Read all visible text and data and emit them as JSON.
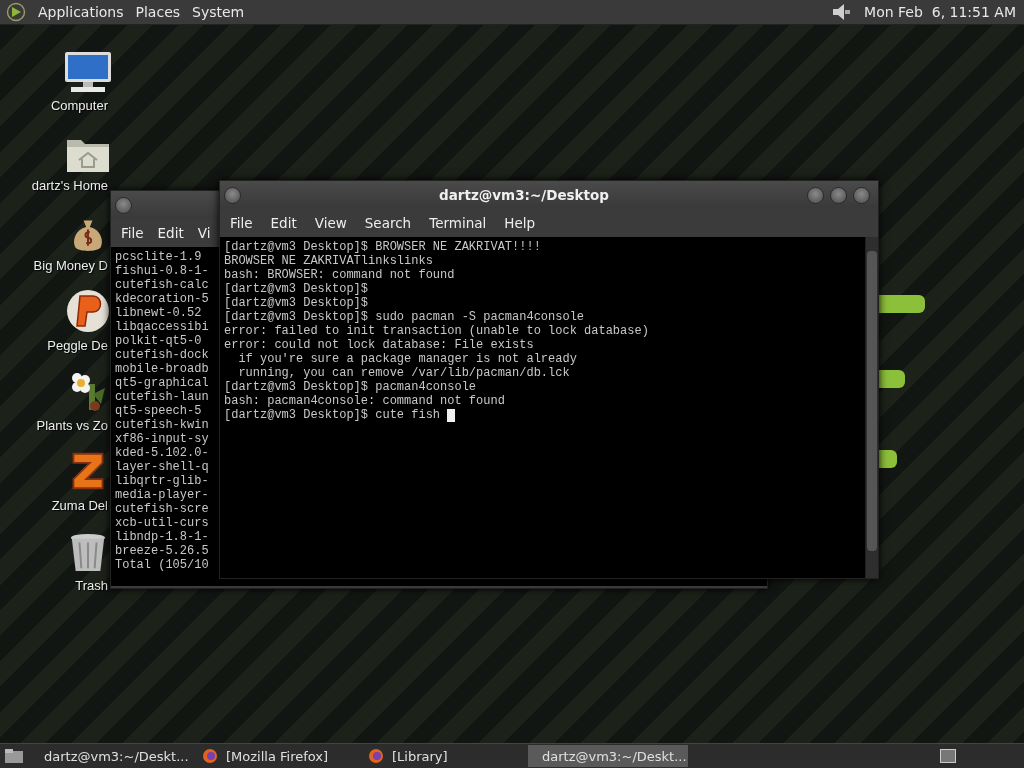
{
  "top_panel": {
    "menus": [
      "Applications",
      "Places",
      "System"
    ],
    "clock": "Mon Feb  6, 11:51 AM"
  },
  "desktop_icons": [
    {
      "kind": "computer",
      "label": "Computer"
    },
    {
      "kind": "home",
      "label": "dartz's Home"
    },
    {
      "kind": "money",
      "label": "Big Money D"
    },
    {
      "kind": "peggle",
      "label": "Peggle De"
    },
    {
      "kind": "plants",
      "label": "Plants vs Zo"
    },
    {
      "kind": "zuma",
      "label": "Zuma Del"
    },
    {
      "kind": "trash",
      "label": "Trash"
    }
  ],
  "back_window": {
    "menus": [
      "File",
      "Edit",
      "Vi"
    ],
    "lines": [
      "pcsclite-1.9",
      "fishui-0.8-1-",
      "cutefish-calc",
      "kdecoration-5",
      "libnewt-0.52",
      "libqaccessibi",
      "polkit-qt5-0",
      "cutefish-dock",
      "mobile-broadb",
      "qt5-graphical",
      "cutefish-laun",
      "qt5-speech-5",
      "cutefish-kwin",
      "xf86-input-sy",
      "kded-5.102.0-",
      "layer-shell-q",
      "libqrtr-glib-",
      "media-player-",
      "cutefish-scre",
      "xcb-util-curs",
      "libndp-1.8-1-",
      "breeze-5.26.5",
      "Total (105/10"
    ]
  },
  "front_window": {
    "title": "dartz@vm3:~/Desktop",
    "menus": [
      "File",
      "Edit",
      "View",
      "Search",
      "Terminal",
      "Help"
    ],
    "lines": [
      "[dartz@vm3 Desktop]$ BROWSER NE ZAKRIVAT!!!!",
      "BROWSER NE ZAKRIVATlinkslinks",
      "bash: BROWSER: command not found",
      "[dartz@vm3 Desktop]$",
      "[dartz@vm3 Desktop]$",
      "[dartz@vm3 Desktop]$ sudo pacman -S pacman4console",
      "error: failed to init transaction (unable to lock database)",
      "error: could not lock database: File exists",
      "  if you're sure a package manager is not already",
      "  running, you can remove /var/lib/pacman/db.lck",
      "[dartz@vm3 Desktop]$ pacman4console",
      "bash: pacman4console: command not found"
    ],
    "prompt": "[dartz@vm3 Desktop]$ cute fish"
  },
  "taskbar": {
    "items": [
      {
        "kind": "terminal",
        "label": "dartz@vm3:~/Deskt...",
        "selected": false
      },
      {
        "kind": "firefox",
        "label": "[Mozilla Firefox]",
        "selected": false
      },
      {
        "kind": "firefox",
        "label": "[Library]",
        "selected": false
      },
      {
        "kind": "terminal",
        "label": "dartz@vm3:~/Deskt...",
        "selected": true
      }
    ]
  }
}
